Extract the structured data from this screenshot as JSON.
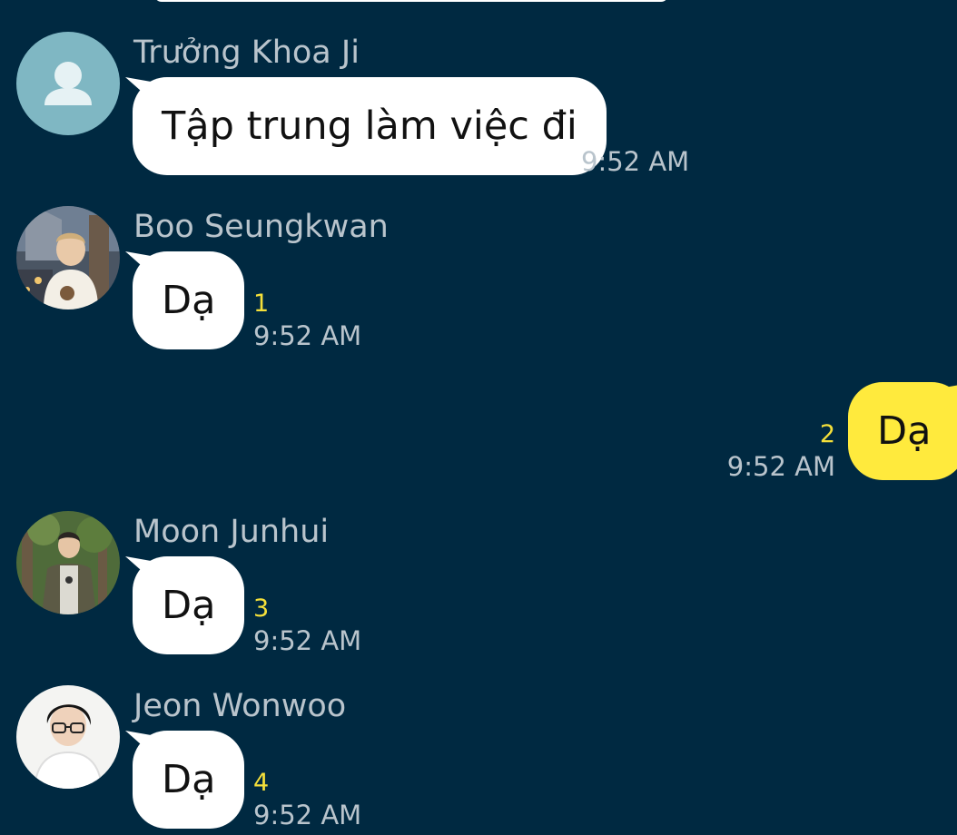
{
  "messages": [
    {
      "sender": "Trưởng Khoa Ji",
      "avatar": "default-profile-icon",
      "text": "Tập trung làm việc đi",
      "time": "9:52 AM",
      "unread": ""
    },
    {
      "sender": "Boo Seungkwan",
      "avatar": "profile-photo",
      "text": "Dạ",
      "time": "9:52 AM",
      "unread": "1"
    },
    {
      "sender": "",
      "outgoing": true,
      "text": "Dạ",
      "time": "9:52 AM",
      "unread": "2"
    },
    {
      "sender": "Moon Junhui",
      "avatar": "profile-photo",
      "text": "Dạ",
      "time": "9:52 AM",
      "unread": "3"
    },
    {
      "sender": "Jeon Wonwoo",
      "avatar": "profile-photo",
      "text": "Dạ",
      "time": "9:52 AM",
      "unread": "4"
    }
  ],
  "colors": {
    "background": "#002941",
    "incoming_bubble": "#ffffff",
    "outgoing_bubble": "#ffea3d",
    "unread_count": "#f5e03a",
    "meta_text": "#b9c4cc"
  }
}
